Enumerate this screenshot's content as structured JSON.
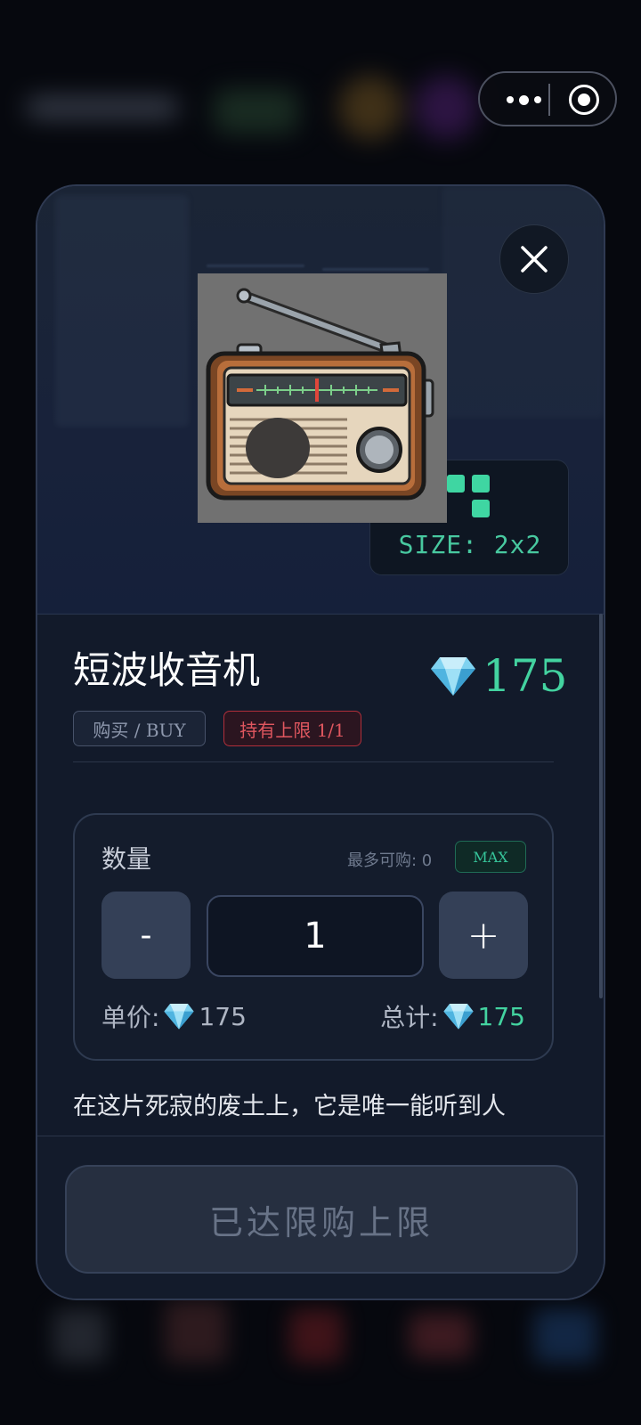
{
  "capsule": {
    "more_icon": "more-dots-icon",
    "close_icon": "target-circle-icon"
  },
  "item": {
    "name": "短波收音机",
    "image_icon": "radio-icon",
    "size_label": "SIZE: 2x2",
    "price": "175",
    "currency_icon": "diamond-icon",
    "tag_buy": "购买 / BUY",
    "tag_limit": "持有上限 1/1",
    "description": "在这片死寂的废土上，它是唯一能听到人"
  },
  "quantity": {
    "label": "数量",
    "max_info": "最多可购: 0",
    "max_button": "MAX",
    "minus": "-",
    "plus": "+",
    "value": "1",
    "unit_label": "单价:",
    "unit_value": "175",
    "total_label": "总计:",
    "total_value": "175"
  },
  "footer": {
    "button_label": "已达限购上限"
  },
  "colors": {
    "accent": "#43d3a0",
    "danger": "#e0575f",
    "panel": "#121a2a"
  }
}
